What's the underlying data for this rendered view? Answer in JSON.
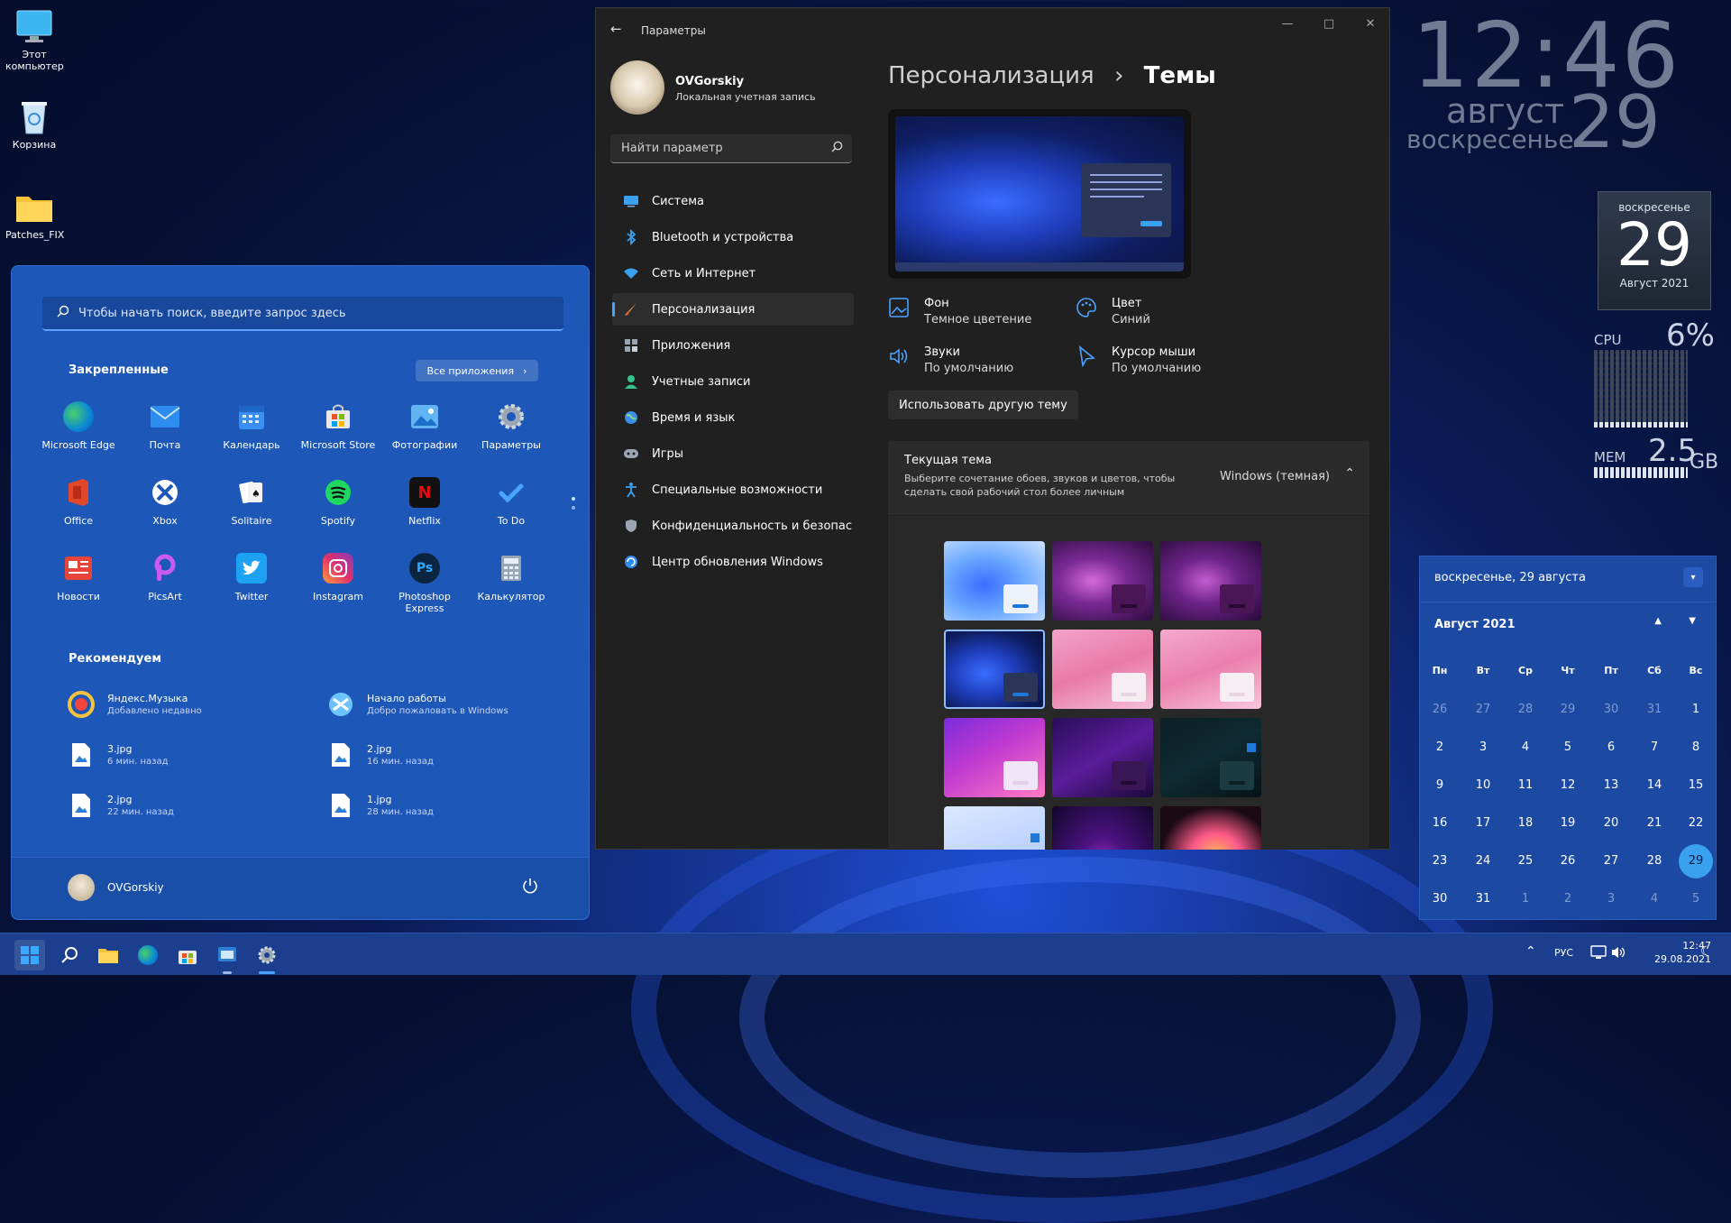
{
  "desktop": {
    "icons": [
      {
        "label": "Этот компьютер"
      },
      {
        "label": "Корзина"
      },
      {
        "label": "Patches_FIX"
      }
    ]
  },
  "start": {
    "search_placeholder": "Чтобы начать поиск, введите запрос здесь",
    "pinned_title": "Закрепленные",
    "all_apps": "Все приложения",
    "apps": [
      {
        "label": "Microsoft Edge",
        "icon": "edge-icon"
      },
      {
        "label": "Почта",
        "icon": "mail-icon"
      },
      {
        "label": "Календарь",
        "icon": "calendar-icon"
      },
      {
        "label": "Microsoft Store",
        "icon": "store-icon"
      },
      {
        "label": "Фотографии",
        "icon": "photos-icon"
      },
      {
        "label": "Параметры",
        "icon": "settings-icon"
      },
      {
        "label": "Office",
        "icon": "office-icon"
      },
      {
        "label": "Xbox",
        "icon": "xbox-icon"
      },
      {
        "label": "Solitaire",
        "icon": "solitaire-icon"
      },
      {
        "label": "Spotify",
        "icon": "spotify-icon"
      },
      {
        "label": "Netflix",
        "icon": "netflix-icon"
      },
      {
        "label": "To Do",
        "icon": "todo-icon"
      },
      {
        "label": "Новости",
        "icon": "news-icon"
      },
      {
        "label": "PicsArt",
        "icon": "picsart-icon"
      },
      {
        "label": "Twitter",
        "icon": "twitter-icon"
      },
      {
        "label": "Instagram",
        "icon": "instagram-icon"
      },
      {
        "label": "Photoshop Express",
        "icon": "photoshop-icon"
      },
      {
        "label": "Калькулятор",
        "icon": "calculator-icon"
      }
    ],
    "recommended_title": "Рекомендуем",
    "recommended": [
      {
        "title": "Яндекс.Музыка",
        "sub": "Добавлено недавно"
      },
      {
        "title": "Начало работы",
        "sub": "Добро пожаловать в Windows"
      },
      {
        "title": "3.jpg",
        "sub": "6 мин. назад"
      },
      {
        "title": "2.jpg",
        "sub": "16 мин. назад"
      },
      {
        "title": "2.jpg",
        "sub": "22 мин. назад"
      },
      {
        "title": "1.jpg",
        "sub": "28 мин. назад"
      }
    ],
    "user": "OVGorskiy"
  },
  "settings": {
    "window_title": "Параметры",
    "user_name": "OVGorskiy",
    "user_sub": "Локальная учетная запись",
    "search_placeholder": "Найти параметр",
    "nav": [
      {
        "label": "Система",
        "icon": "system-icon"
      },
      {
        "label": "Bluetooth и устройства",
        "icon": "bluetooth-icon"
      },
      {
        "label": "Сеть и Интернет",
        "icon": "network-icon"
      },
      {
        "label": "Персонализация",
        "icon": "brush-icon"
      },
      {
        "label": "Приложения",
        "icon": "apps-icon"
      },
      {
        "label": "Учетные записи",
        "icon": "account-icon"
      },
      {
        "label": "Время и язык",
        "icon": "globe-icon"
      },
      {
        "label": "Игры",
        "icon": "gamepad-icon"
      },
      {
        "label": "Специальные возможности",
        "icon": "accessibility-icon"
      },
      {
        "label": "Конфиденциальность и безопас",
        "icon": "shield-icon"
      },
      {
        "label": "Центр обновления Windows",
        "icon": "update-icon"
      }
    ],
    "breadcrumb_parent": "Персонализация",
    "breadcrumb_sep": "›",
    "breadcrumb_current": "Темы",
    "options": [
      {
        "title": "Фон",
        "value": "Темное цветение"
      },
      {
        "title": "Цвет",
        "value": "Синий"
      },
      {
        "title": "Звуки",
        "value": "По умолчанию"
      },
      {
        "title": "Курсор мыши",
        "value": "По умолчанию"
      }
    ],
    "use_other_theme": "Использовать другую тему",
    "current_theme": {
      "title": "Текущая тема",
      "desc": "Выберите сочетание обоев, звуков и цветов, чтобы сделать свой рабочий стол более личным",
      "value": "Windows (темная)"
    }
  },
  "clock": {
    "time": "12:46",
    "month": "август",
    "day": "29",
    "weekday": "воскресенье"
  },
  "date_widget": {
    "weekday": "воскресенье",
    "day": "29",
    "month_year": "Август 2021"
  },
  "meters": {
    "cpu_label": "CPU",
    "cpu_value": "6%",
    "cpu_fraction": 0.06,
    "mem_label": "MEM",
    "mem_value": "2.5",
    "mem_unit": "GB"
  },
  "calendar": {
    "header": "воскресенье, 29 августа",
    "month": "Август 2021",
    "weekdays": [
      "Пн",
      "Вт",
      "Ср",
      "Чт",
      "Пт",
      "Сб",
      "Вс"
    ],
    "days": [
      [
        "26",
        "27",
        "28",
        "29",
        "30",
        "31",
        "1"
      ],
      [
        "2",
        "3",
        "4",
        "5",
        "6",
        "7",
        "8"
      ],
      [
        "9",
        "10",
        "11",
        "12",
        "13",
        "14",
        "15"
      ],
      [
        "16",
        "17",
        "18",
        "19",
        "20",
        "21",
        "22"
      ],
      [
        "23",
        "24",
        "25",
        "26",
        "27",
        "28",
        "29"
      ],
      [
        "30",
        "31",
        "1",
        "2",
        "3",
        "4",
        "5"
      ]
    ],
    "today": "29"
  },
  "taskbar": {
    "lang": "РУС",
    "time": "12:47",
    "date": "29.08.2021"
  },
  "colors": {
    "accent": "#4aa3ff",
    "start_bg": "#1d57b8",
    "settings_bg": "#202020",
    "calendar_today": "#3aa0f0"
  }
}
